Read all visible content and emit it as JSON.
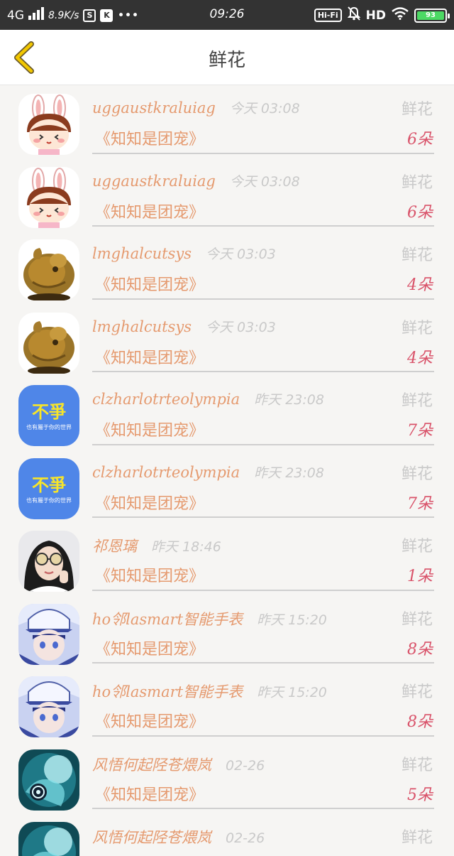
{
  "status_bar": {
    "network": "4G",
    "speed": "8.9K/s",
    "time": "09:26",
    "hifi": "Hi-Fi",
    "hd": "HD",
    "battery": "93",
    "colors": {
      "bar_bg": "#333333",
      "battery_fill": "#4cd964"
    }
  },
  "nav": {
    "title": "鲜花",
    "back_icon": "chevron-left-icon",
    "back_color": "#e2b300"
  },
  "colors": {
    "username": "#e59a6f",
    "muted": "#c9c9c9",
    "count": "#d9536a"
  },
  "rows": [
    {
      "avatar": "rabbit",
      "user": "uggaustkraluiag",
      "time": "今天 03:08",
      "type": "鲜花",
      "book": "《知知是团宠》",
      "count": "6朵"
    },
    {
      "avatar": "rabbit",
      "user": "uggaustkraluiag",
      "time": "今天 03:08",
      "type": "鲜花",
      "book": "《知知是团宠》",
      "count": "6朵"
    },
    {
      "avatar": "carving",
      "user": "lmghalcutsys",
      "time": "今天 03:03",
      "type": "鲜花",
      "book": "《知知是团宠》",
      "count": "4朵"
    },
    {
      "avatar": "carving",
      "user": "lmghalcutsys",
      "time": "今天 03:03",
      "type": "鲜花",
      "book": "《知知是团宠》",
      "count": "4朵"
    },
    {
      "avatar": "blue-text",
      "user": "clzharlotrteolympia",
      "time": "昨天 23:08",
      "type": "鲜花",
      "book": "《知知是团宠》",
      "count": "7朵",
      "avatar_text": "不爭",
      "avatar_sub": "也有屬于你的世界"
    },
    {
      "avatar": "blue-text",
      "user": "clzharlotrteolympia",
      "time": "昨天 23:08",
      "type": "鲜花",
      "book": "《知知是团宠》",
      "count": "7朵",
      "avatar_text": "不爭",
      "avatar_sub": "也有屬于你的世界"
    },
    {
      "avatar": "girl",
      "user": "祁恩璃",
      "time": "昨天 18:46",
      "type": "鲜花",
      "book": "《知知是团宠》",
      "count": "1朵"
    },
    {
      "avatar": "anime-blue",
      "user": "ho邻lasmart智能手表",
      "time": "昨天 15:20",
      "type": "鲜花",
      "book": "《知知是团宠》",
      "count": "8朵"
    },
    {
      "avatar": "anime-blue",
      "user": "ho邻lasmart智能手表",
      "time": "昨天 15:20",
      "type": "鲜花",
      "book": "《知知是团宠》",
      "count": "8朵"
    },
    {
      "avatar": "anime-teal",
      "user": "风悟何起陉苍煨岚",
      "time": "02-26",
      "type": "鲜花",
      "book": "《知知是团宠》",
      "count": "5朵"
    },
    {
      "avatar": "anime-teal",
      "user": "风悟何起陉苍煨岚",
      "time": "02-26",
      "type": "鲜花",
      "book": "",
      "count": ""
    }
  ]
}
